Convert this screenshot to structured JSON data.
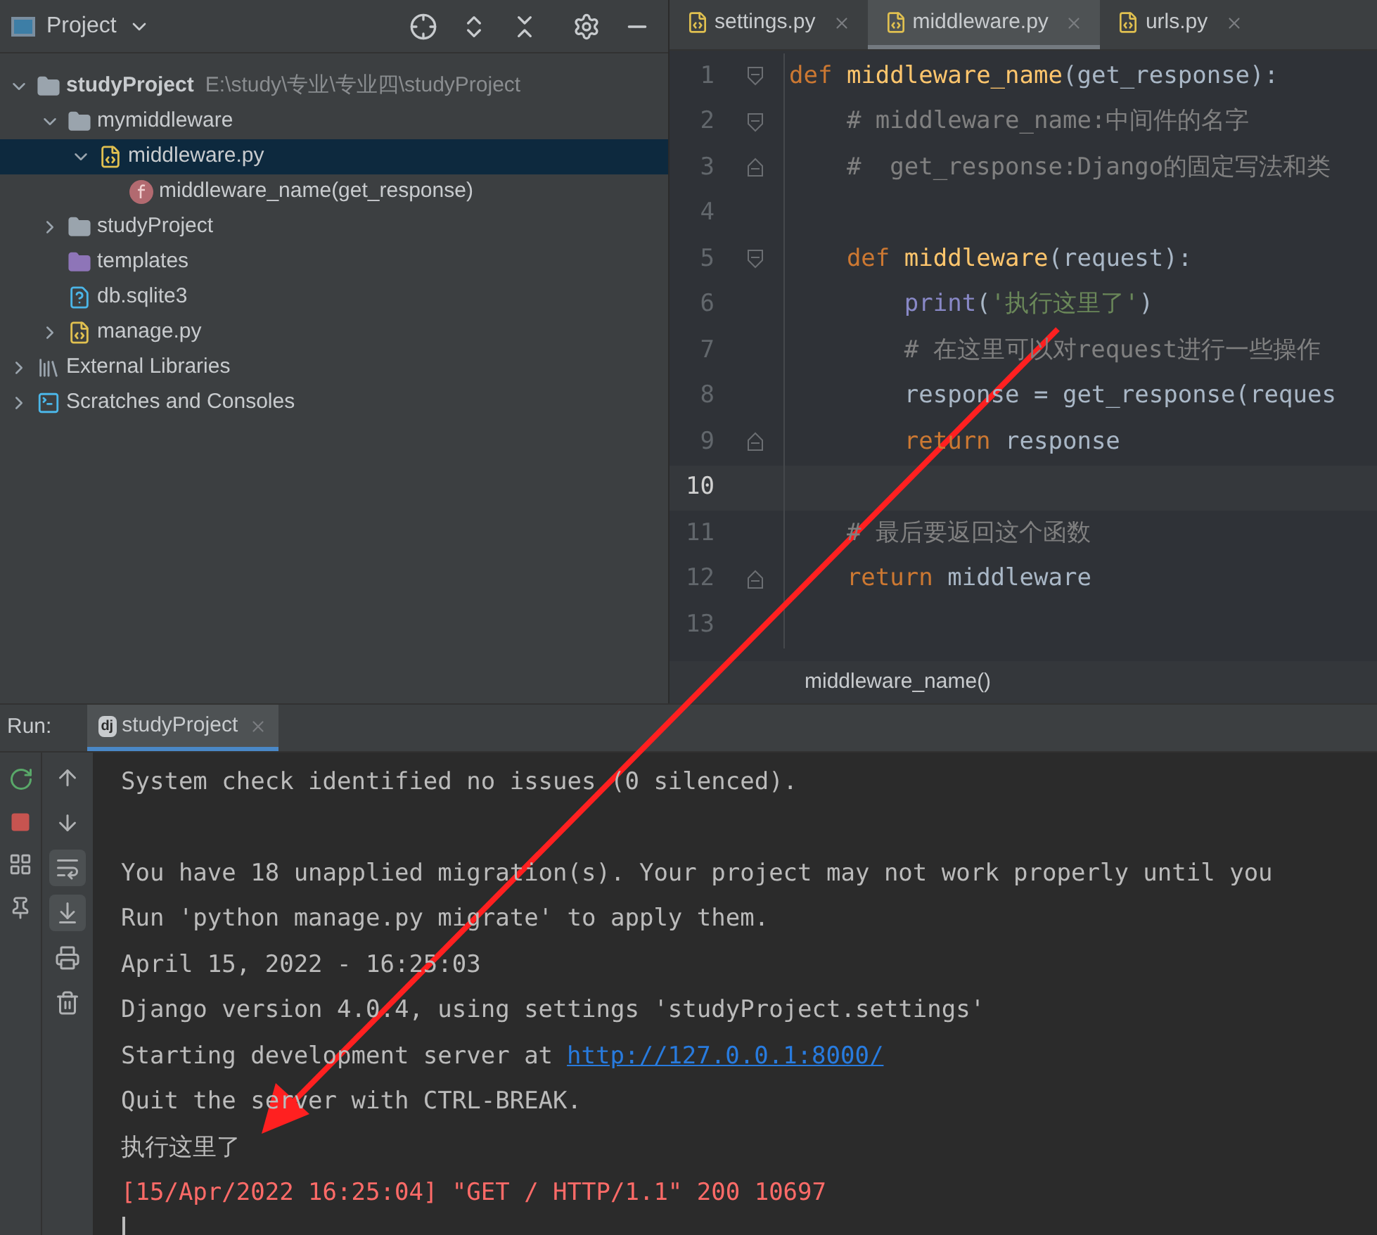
{
  "project_panel": {
    "title": "Project",
    "tree": [
      {
        "name": "studyProject",
        "path": "E:\\study\\专业\\专业四\\studyProject",
        "kind": "project",
        "expanded": true,
        "selected": false,
        "children": [
          {
            "name": "mymiddleware",
            "kind": "folder",
            "expanded": true,
            "selected": false,
            "children": [
              {
                "name": "middleware.py",
                "kind": "python",
                "expanded": true,
                "selected": true,
                "children": [
                  {
                    "name": "middleware_name(get_response)",
                    "kind": "function",
                    "selected": false
                  }
                ]
              }
            ]
          },
          {
            "name": "studyProject",
            "kind": "package",
            "expanded": false,
            "selected": false
          },
          {
            "name": "templates",
            "kind": "templates",
            "selected": false
          },
          {
            "name": "db.sqlite3",
            "kind": "unknown",
            "selected": false
          },
          {
            "name": "manage.py",
            "kind": "python",
            "expanded": false,
            "selected": false
          }
        ]
      },
      {
        "name": "External Libraries",
        "kind": "libraries",
        "expanded": false,
        "selected": false
      },
      {
        "name": "Scratches and Consoles",
        "kind": "scratches",
        "expanded": false,
        "selected": false
      }
    ]
  },
  "editor": {
    "tabs": [
      {
        "label": "settings.py",
        "selected": false
      },
      {
        "label": "middleware.py",
        "selected": true
      },
      {
        "label": "urls.py",
        "selected": false
      }
    ],
    "lines": [
      {
        "number": "1",
        "fold_start": true,
        "fold_end": false,
        "current": false,
        "tokens": [
          {
            "text": "def ",
            "kind": "keyword"
          },
          {
            "text": "middleware_name",
            "kind": "function"
          },
          {
            "text": "(get_response):",
            "kind": "plain"
          }
        ]
      },
      {
        "number": "2",
        "fold_start": true,
        "fold_end": false,
        "current": false,
        "tokens": [
          {
            "text": "    # middleware_name:中间件的名字",
            "kind": "comment"
          }
        ]
      },
      {
        "number": "3",
        "fold_start": false,
        "fold_end": true,
        "current": false,
        "tokens": [
          {
            "text": "    #  get_response:Django的固定写法和类",
            "kind": "comment"
          }
        ]
      },
      {
        "number": "4",
        "fold_start": false,
        "fold_end": false,
        "current": false
      },
      {
        "number": "5",
        "fold_start": true,
        "fold_end": false,
        "current": false,
        "tokens": [
          {
            "text": "    def ",
            "kind": "keyword"
          },
          {
            "text": "middleware",
            "kind": "function"
          },
          {
            "text": "(request):",
            "kind": "plain"
          }
        ]
      },
      {
        "number": "6",
        "fold_start": false,
        "fold_end": false,
        "current": false,
        "tokens": [
          {
            "text": "        print",
            "kind": "builtin"
          },
          {
            "text": "(",
            "kind": "plain"
          },
          {
            "text": "'执行这里了'",
            "kind": "string"
          },
          {
            "text": ")",
            "kind": "plain"
          }
        ]
      },
      {
        "number": "7",
        "fold_start": false,
        "fold_end": false,
        "current": false,
        "tokens": [
          {
            "text": "        # 在这里可以对request进行一些操作",
            "kind": "comment"
          }
        ]
      },
      {
        "number": "8",
        "fold_start": false,
        "fold_end": false,
        "current": false,
        "tokens": [
          {
            "text": "        response = get_response(reques",
            "kind": "plain"
          }
        ]
      },
      {
        "number": "9",
        "fold_start": false,
        "fold_end": true,
        "current": false,
        "tokens": [
          {
            "text": "        return ",
            "kind": "keyword"
          },
          {
            "text": "response",
            "kind": "plain"
          }
        ]
      },
      {
        "number": "10",
        "fold_start": false,
        "fold_end": false,
        "current": true
      },
      {
        "number": "11",
        "fold_start": false,
        "fold_end": false,
        "current": false,
        "tokens": [
          {
            "text": "    # 最后要返回这个函数",
            "kind": "comment"
          }
        ]
      },
      {
        "number": "12",
        "fold_start": false,
        "fold_end": true,
        "current": false,
        "tokens": [
          {
            "text": "    return ",
            "kind": "keyword"
          },
          {
            "text": "middleware",
            "kind": "plain"
          }
        ]
      },
      {
        "number": "13",
        "fold_start": false,
        "fold_end": false,
        "current": false
      }
    ],
    "breadcrumb": "middleware_name()"
  },
  "run": {
    "label": "Run:",
    "tabs": [
      {
        "label": "studyProject",
        "icon_text": "dj",
        "selected": true
      }
    ],
    "side_tools": [
      {
        "kind": "rerun"
      },
      {
        "kind": "stop"
      },
      {
        "kind": "layout"
      },
      {
        "kind": "pin"
      }
    ],
    "tools": [
      {
        "kind": "up",
        "on": false
      },
      {
        "kind": "down",
        "on": false
      },
      {
        "kind": "wrap",
        "on": true
      },
      {
        "kind": "scroll-end",
        "on": true
      },
      {
        "kind": "print",
        "on": false
      },
      {
        "kind": "delete",
        "on": false
      }
    ],
    "console": [
      {
        "kind": "text",
        "text": "System check identified no issues (0 silenced)."
      },
      {
        "kind": "blank"
      },
      {
        "kind": "text",
        "text": "You have 18 unapplied migration(s). Your project may not work properly until you"
      },
      {
        "kind": "text",
        "text": "Run 'python manage.py migrate' to apply them."
      },
      {
        "kind": "text",
        "text": "April 15, 2022 - 16:25:03"
      },
      {
        "kind": "text",
        "text": "Django version 4.0.4, using settings 'studyProject.settings'"
      },
      {
        "kind": "link",
        "text": "Starting development server at",
        "link": "http://127.0.0.1:8000/"
      },
      {
        "kind": "text",
        "text": "Quit the server with CTRL-BREAK."
      },
      {
        "kind": "text",
        "text": "执行这里了"
      },
      {
        "kind": "error",
        "text": "[15/Apr/2022 16:25:04] \"GET / HTTP/1.1\" 200 10697"
      }
    ]
  }
}
